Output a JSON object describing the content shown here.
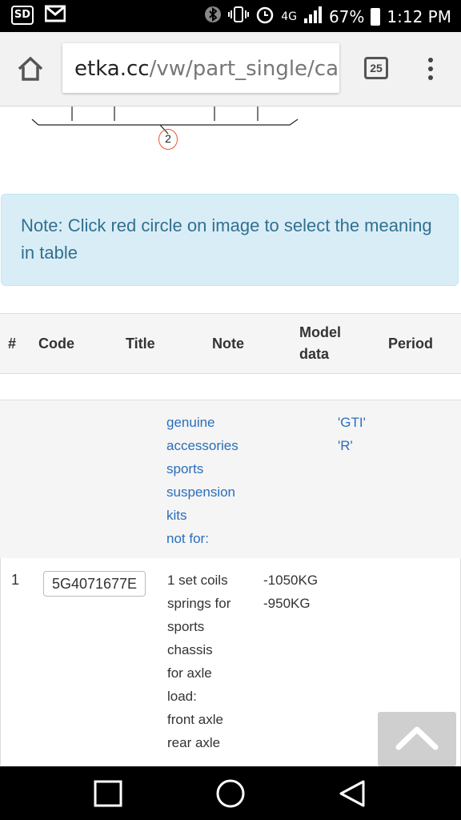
{
  "status_bar": {
    "left_icons": [
      "sd-card-icon",
      "gmail-icon"
    ],
    "sd_label": "SD",
    "network": "4G",
    "battery": "67%",
    "time": "1:12 PM"
  },
  "browser": {
    "url_host": "etka.cc",
    "url_path": "/vw/part_single/ca",
    "tab_count": "25"
  },
  "diagram": {
    "callout": "2"
  },
  "note": {
    "text": "Note: Click red circle on image to select the meaning in table"
  },
  "table": {
    "headers": {
      "num": "#",
      "code": "Code",
      "title": "Title",
      "note": "Note",
      "model_line1": "Model",
      "model_line2": "data",
      "period": "Period"
    },
    "group": {
      "lines": [
        "genuine",
        "accessories",
        "sports",
        "suspension",
        "kits",
        "not for:"
      ],
      "model_lines": [
        "'GTI'",
        "'R'"
      ]
    },
    "part": {
      "num": "1",
      "code": "5G4071677E",
      "lines": [
        "1 set coils",
        "springs for",
        "sports",
        "chassis",
        "for axle",
        "load:",
        "front axle",
        "rear axle"
      ],
      "note_lines": [
        "-1050KG",
        "-950KG"
      ]
    }
  },
  "colors": {
    "link": "#2a6ebb",
    "note_bg": "#d9edf7",
    "note_text": "#31708f",
    "callout": "#e8542a"
  }
}
